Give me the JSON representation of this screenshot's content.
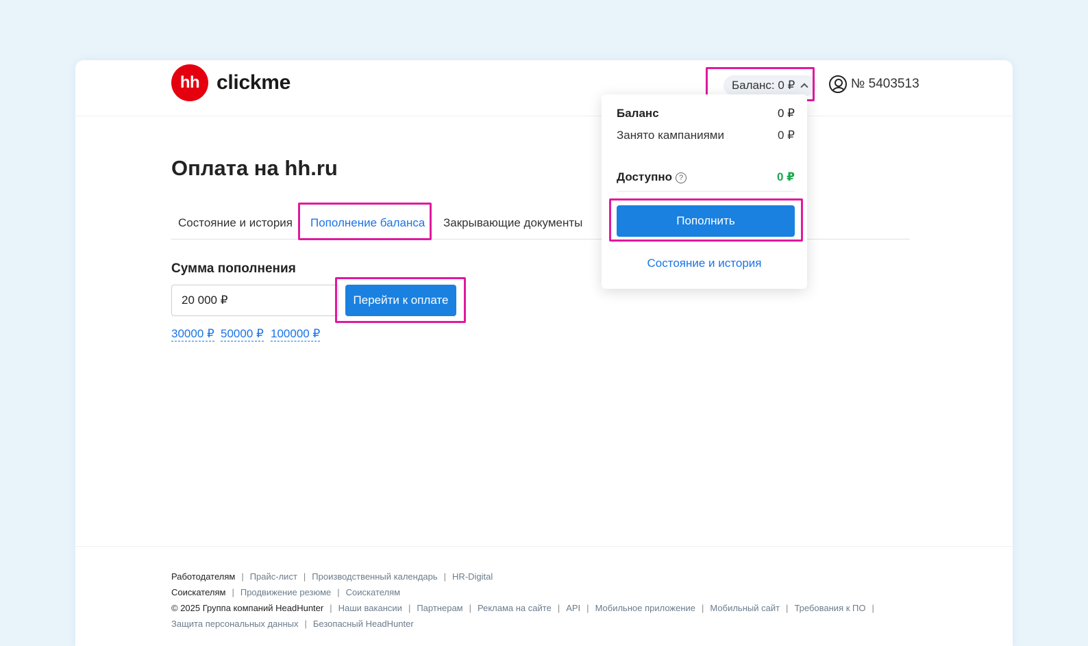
{
  "header": {
    "logo_mark": "hh",
    "logo_text": "clickme",
    "balance_button": "Баланс: 0 ₽",
    "account_number": "№ 5403513"
  },
  "page": {
    "title": "Оплата на hh.ru",
    "tabs": [
      {
        "label": "Состояние и история"
      },
      {
        "label": "Пополнение баланса",
        "active": true
      },
      {
        "label": "Закрывающие документы"
      }
    ]
  },
  "topup": {
    "label": "Сумма пополнения",
    "input_value": "20 000 ₽",
    "pay_button": "Перейти к оплате",
    "quick_amounts": [
      "30000 ₽",
      "50000 ₽",
      "100000 ₽"
    ]
  },
  "balance_dropdown": {
    "balance_label": "Баланс",
    "balance_value": "0 ₽",
    "reserved_label": "Занято кампаниями",
    "reserved_value": "0 ₽",
    "available_label": "Доступно",
    "available_value": "0 ₽",
    "help_glyph": "?",
    "topup_button": "Пополнить",
    "history_link": "Состояние и история"
  },
  "footer": {
    "row1": [
      "Работодателям",
      "Прайс-лист",
      "Производственный календарь",
      "HR-Digital"
    ],
    "row2": [
      "Соискателям",
      "Продвижение резюме",
      "Соискателям"
    ],
    "row3": [
      "© 2025 Группа компаний HeadHunter",
      "Наши вакансии",
      "Партнерам",
      "Реклама на сайте",
      "API",
      "Мобильное приложение",
      "Мобильный сайт",
      "Требования к ПО"
    ],
    "row4": [
      "Защита персональных данных",
      "Безопасный HeadHunter"
    ],
    "separator": "|"
  },
  "colors": {
    "highlight": "#e0199e",
    "primary": "#1a81e0",
    "link": "#1a73e8",
    "available_green": "#1aa84f",
    "logo_red": "#e4000f"
  }
}
